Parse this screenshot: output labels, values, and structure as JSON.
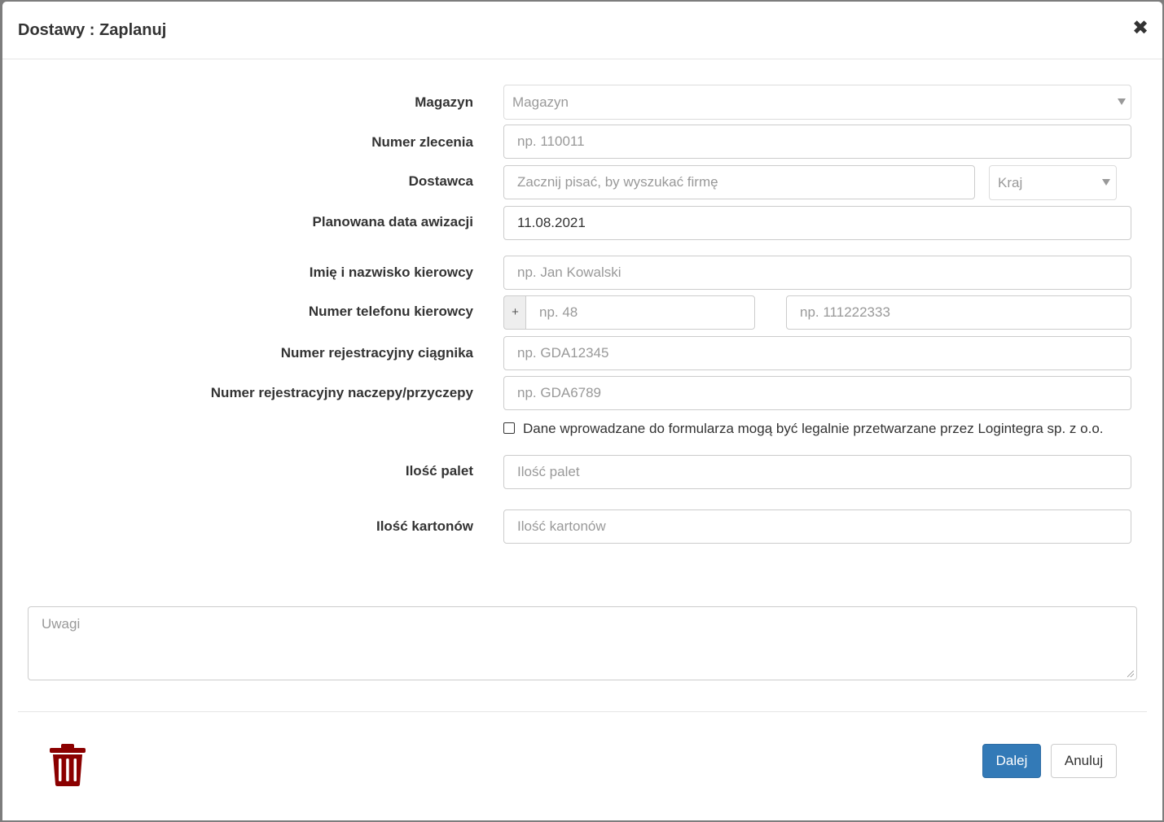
{
  "header": {
    "title": "Dostawy : Zaplanuj",
    "close_glyph": "✖"
  },
  "form": {
    "warehouse": {
      "label": "Magazyn",
      "selected": "Magazyn"
    },
    "order_number": {
      "label": "Numer zlecenia",
      "placeholder": "np. 110011"
    },
    "supplier": {
      "label": "Dostawca",
      "placeholder": "Zacznij pisać, by wyszukać firmę",
      "country_selected": "Kraj"
    },
    "planned_date": {
      "label": "Planowana data awizacji",
      "value": "11.08.2021"
    },
    "driver_name": {
      "label": "Imię i nazwisko kierowcy",
      "placeholder": "np. Jan Kowalski"
    },
    "driver_phone": {
      "label": "Numer telefonu kierowcy",
      "prefix": "+",
      "country_code_placeholder": "np. 48",
      "number_placeholder": "np. 111222333"
    },
    "tractor_plate": {
      "label": "Numer rejestracyjny ciągnika",
      "placeholder": "np. GDA12345"
    },
    "trailer_plate": {
      "label": "Numer rejestracyjny naczepy/przyczepy",
      "placeholder": "np. GDA6789"
    },
    "consent": {
      "label": "Dane wprowadzane do formularza mogą być legalnie przetwarzane przez Logintegra sp. z o.o.",
      "checked": false
    },
    "pallets": {
      "label": "Ilość palet",
      "placeholder": "Ilość palet"
    },
    "cartons": {
      "label": "Ilość kartonów",
      "placeholder": "Ilość kartonów"
    },
    "notes": {
      "placeholder": "Uwagi"
    }
  },
  "footer": {
    "next_label": "Dalej",
    "cancel_label": "Anuluj",
    "delete_icon": "trash-icon"
  },
  "colors": {
    "primary": "#337ab7",
    "danger": "#8b0000"
  }
}
